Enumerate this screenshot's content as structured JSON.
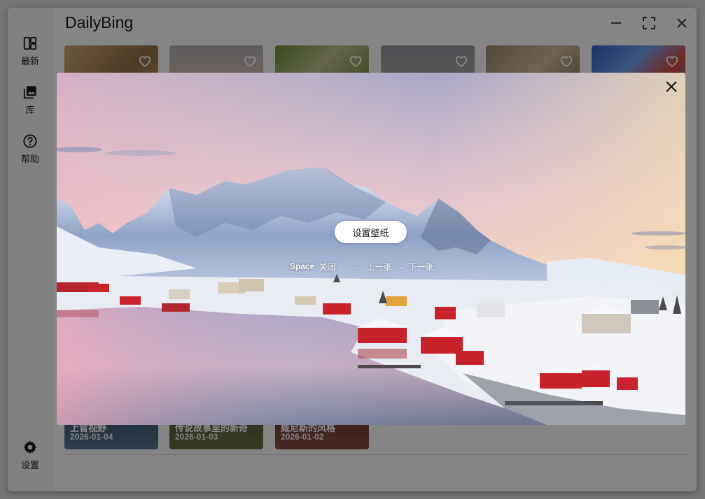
{
  "app": {
    "title": "DailyBing"
  },
  "sidebar": {
    "items": [
      {
        "label": "最新",
        "icon": "dashboard-icon"
      },
      {
        "label": "库",
        "icon": "photo-library-icon"
      },
      {
        "label": "帮助",
        "icon": "help-circle-icon"
      }
    ],
    "settings": {
      "label": "设置",
      "icon": "gear-icon"
    }
  },
  "window_controls": [
    "minimize-icon",
    "maximize-icon",
    "close-icon"
  ],
  "gallery": {
    "top_cards": [
      {
        "icon": "heart-outline-icon",
        "favorited": false
      },
      {
        "icon": "heart-outline-icon",
        "favorited": false
      },
      {
        "icon": "heart-outline-icon",
        "favorited": false
      },
      {
        "icon": "heart-outline-icon",
        "favorited": false
      },
      {
        "icon": "heart-outline-icon",
        "favorited": false
      },
      {
        "icon": "heart-outline-icon",
        "favorited": false
      }
    ],
    "bottom_cards": [
      {
        "title": "上官视野",
        "date": "2026-01-04"
      },
      {
        "title": "传说故事里的新奇",
        "date": "2026-01-03"
      },
      {
        "title": "威尼斯的风格",
        "date": "2026-01-02"
      }
    ]
  },
  "preview": {
    "set_wallpaper_label": "设置壁纸",
    "close_icon": "close-icon",
    "hints": {
      "space_key": "Space",
      "space_action": "关闭",
      "prev_key": "←",
      "prev_action": "上一张",
      "next_key": "→",
      "next_action": "下一张"
    }
  },
  "colors": {
    "accent_house_red": "#c8232c",
    "window_bg": "#f3f3f3",
    "overlay": "rgba(0,0,0,0.45)"
  }
}
